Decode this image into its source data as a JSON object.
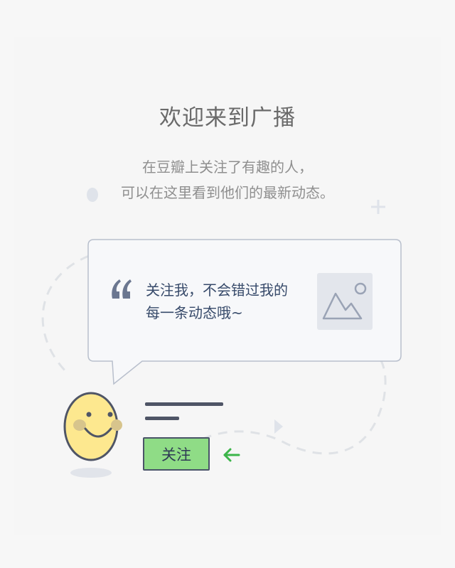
{
  "header": {
    "title": "欢迎来到广播",
    "subtitle_line1": "在豆瓣上关注了有趣的人，",
    "subtitle_line2": "可以在这里看到他们的最新动态。"
  },
  "bubble": {
    "quote_mark": "“",
    "text_line1": "关注我，不会错过我的",
    "text_line2": "每一条动态哦~",
    "image_icon": "image-placeholder-icon"
  },
  "profile": {
    "avatar_icon": "smiley-face-icon",
    "follow_label": "关注",
    "arrow_icon": "arrow-left-icon"
  },
  "colors": {
    "accent_green": "#8fdc86",
    "arrow_green": "#3cb54a",
    "ink": "#374a6a",
    "smiley_yellow": "#fde88f"
  }
}
